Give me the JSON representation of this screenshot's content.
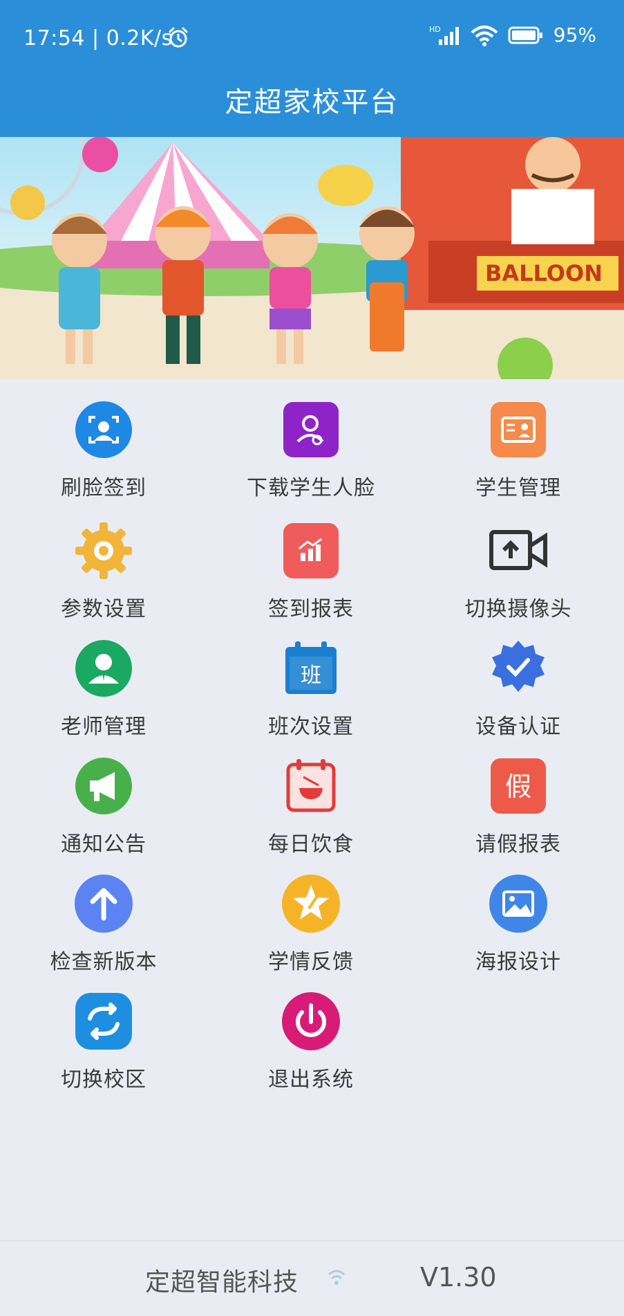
{
  "status_bar": {
    "time_speed": "17:54 | 0.2K/s",
    "battery": "95%"
  },
  "header": {
    "title": "定超家校平台"
  },
  "banner": {
    "sign_text": "BALLOON"
  },
  "menu": [
    {
      "label": "刷脸签到",
      "icon": "face-scan-icon",
      "color": "#1e88e5"
    },
    {
      "label": "下载学生人脸",
      "icon": "download-face-icon",
      "color": "#8e24c8"
    },
    {
      "label": "学生管理",
      "icon": "student-card-icon",
      "color": "#f58a4a"
    },
    {
      "label": "参数设置",
      "icon": "gear-icon",
      "color": "#f2b53a"
    },
    {
      "label": "签到报表",
      "icon": "chart-icon",
      "color": "#f05b5b"
    },
    {
      "label": "切换摄像头",
      "icon": "camera-switch-icon",
      "color": "#333333"
    },
    {
      "label": "老师管理",
      "icon": "teacher-icon",
      "color": "#1aa862"
    },
    {
      "label": "班次设置",
      "icon": "class-calendar-icon",
      "color": "#1b7fd0"
    },
    {
      "label": "设备认证",
      "icon": "verified-badge-icon",
      "color": "#3a6fe0"
    },
    {
      "label": "通知公告",
      "icon": "megaphone-icon",
      "color": "#48b04a"
    },
    {
      "label": "每日饮食",
      "icon": "meal-calendar-icon",
      "color": "#e23b3b"
    },
    {
      "label": "请假报表",
      "icon": "leave-icon",
      "color": "#ee5a4a"
    },
    {
      "label": "检查新版本",
      "icon": "update-arrow-icon",
      "color": "#5b84f2"
    },
    {
      "label": "学情反馈",
      "icon": "feedback-star-icon",
      "color": "#f5b428"
    },
    {
      "label": "海报设计",
      "icon": "poster-image-icon",
      "color": "#3f86e8"
    },
    {
      "label": "切换校区",
      "icon": "switch-campus-icon",
      "color": "#1e8fe0"
    },
    {
      "label": "退出系统",
      "icon": "power-icon",
      "color": "#d81b77"
    }
  ],
  "icon_glyphs": {
    "class": "班",
    "leave": "假"
  },
  "footer": {
    "company": "定超智能科技",
    "version": "V1.30"
  }
}
